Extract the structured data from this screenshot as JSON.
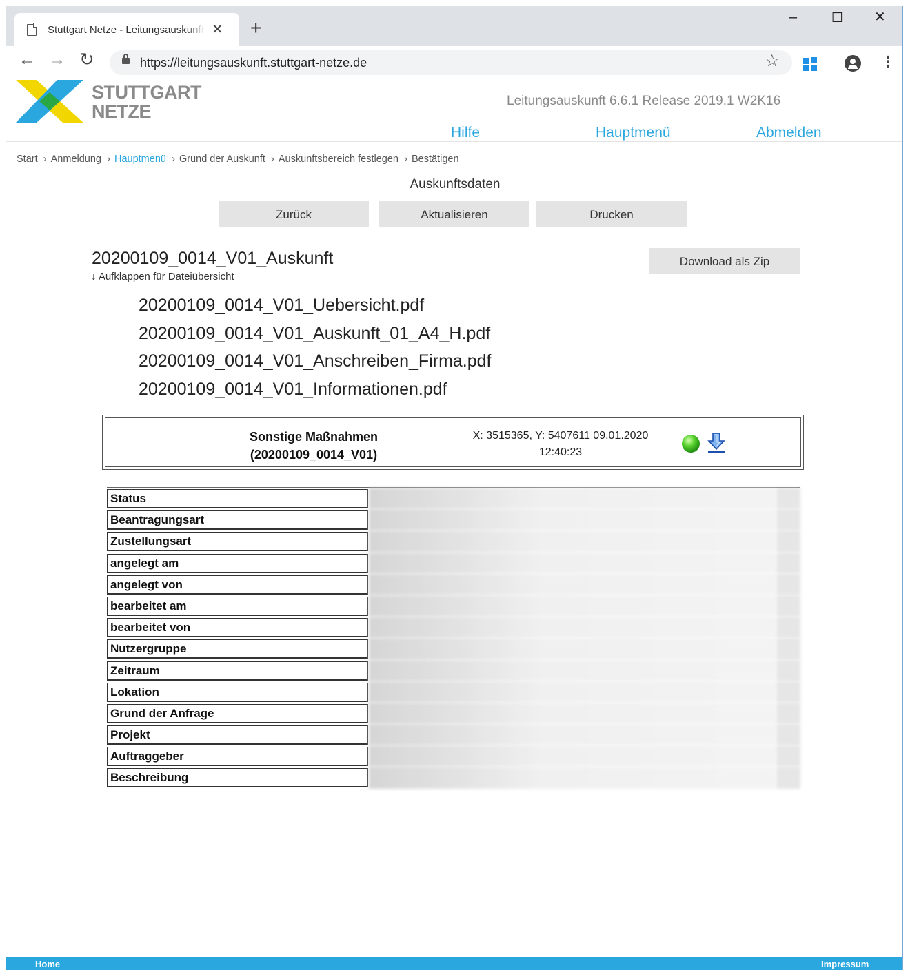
{
  "browser": {
    "tab_title": "Stuttgart Netze - Leitungsauskunft",
    "tab_close": "✕",
    "new_tab": "+",
    "url": "https://leitungsauskunft.stuttgart-netze.de",
    "controls": {
      "minimize": "–",
      "maximize": "☐",
      "close": "✕"
    },
    "nav": {
      "back": "←",
      "forward": "→",
      "reload": "↻",
      "bookmark": "☆",
      "menu": "⋮"
    }
  },
  "header": {
    "brand_line1": "STUTTGART",
    "brand_line2": "NETZE",
    "version": "Leitungsauskunft 6.6.1 Release 2019.1 W2K16",
    "nav": {
      "help": "Hilfe",
      "main_menu": "Hauptmenü",
      "logout": "Abmelden"
    }
  },
  "breadcrumb": [
    {
      "label": "Start"
    },
    {
      "label": "Anmeldung"
    },
    {
      "label": "Hauptmenü",
      "active": true
    },
    {
      "label": "Grund der Auskunft"
    },
    {
      "label": "Auskunftsbereich festlegen"
    },
    {
      "label": "Bestätigen"
    }
  ],
  "page": {
    "title": "Auskunftsdaten",
    "buttons": {
      "back": "Zurück",
      "refresh": "Aktualisieren",
      "print": "Drucken",
      "download_zip": "Download als Zip"
    }
  },
  "auskunft": {
    "name": "20200109_0014_V01_Auskunft",
    "expand_hint": "↓ Aufklappen für Dateiübersicht",
    "files": [
      "20200109_0014_V01_Uebersicht.pdf",
      "20200109_0014_V01_Auskunft_01_A4_H.pdf",
      "20200109_0014_V01_Anschreiben_Firma.pdf",
      "20200109_0014_V01_Informationen.pdf"
    ]
  },
  "info_box": {
    "title_line1": "Sonstige Maßnahmen",
    "title_line2": "(20200109_0014_V01)",
    "coords_line1": "X: 3515365, Y: 5407611 09.01.2020",
    "coords_line2": "12:40:23",
    "status_color": "#3cbc1e",
    "icons": [
      "status-green-icon",
      "download-icon"
    ]
  },
  "details_table": {
    "rows": [
      "Status",
      "Beantragungsart",
      "Zustellungsart",
      "angelegt am",
      "angelegt von",
      "bearbeitet am",
      "bearbeitet von",
      "Nutzergruppe",
      "Zeitraum",
      "Lokation",
      "Grund der Anfrage",
      "Projekt",
      "Auftraggeber",
      "Beschreibung"
    ]
  },
  "footer": {
    "home": "Home",
    "impressum": "Impressum"
  },
  "colors": {
    "accent": "#2aa7df",
    "logo_yellow": "#f2d600",
    "logo_green": "#2aa745",
    "logo_blue": "#2aa7df",
    "button_bg": "#e4e4e4"
  }
}
